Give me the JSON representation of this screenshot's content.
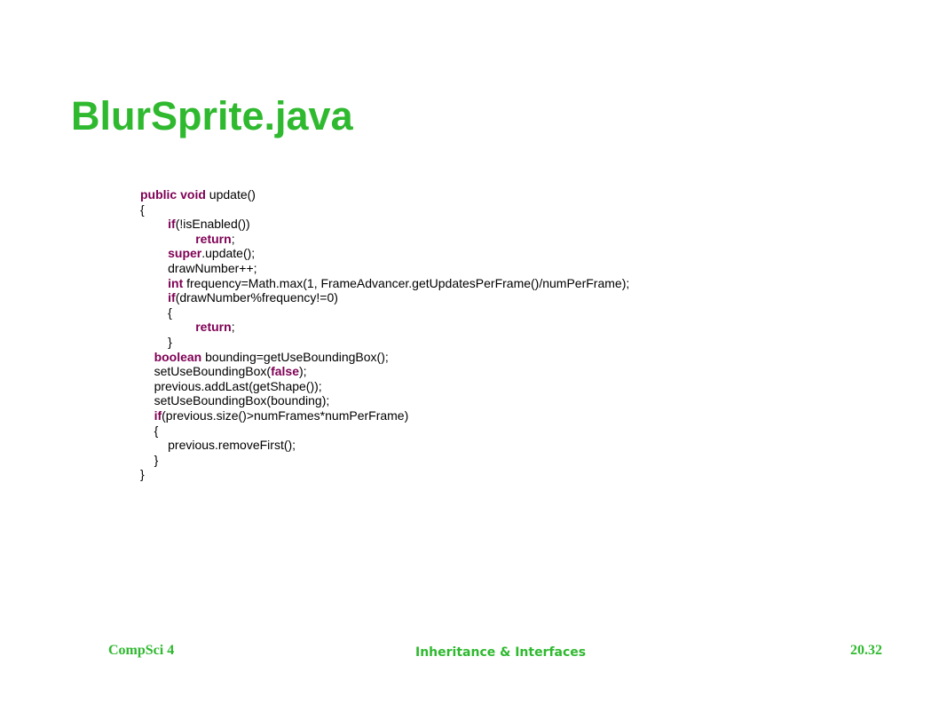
{
  "slide": {
    "title": "BlurSprite.java",
    "code_lines": [
      {
        "indent": "",
        "tokens": [
          {
            "t": "public",
            "kw": true
          },
          {
            "t": " "
          },
          {
            "t": "void",
            "kw": true
          },
          {
            "t": " update()"
          }
        ]
      },
      {
        "indent": "",
        "tokens": [
          {
            "t": "{"
          }
        ]
      },
      {
        "indent": "        ",
        "tokens": [
          {
            "t": "if",
            "kw": true
          },
          {
            "t": "(!isEnabled())"
          }
        ]
      },
      {
        "indent": "                ",
        "tokens": [
          {
            "t": "return",
            "kw": true
          },
          {
            "t": ";"
          }
        ]
      },
      {
        "indent": "        ",
        "tokens": [
          {
            "t": "super",
            "kw": true
          },
          {
            "t": ".update();"
          }
        ]
      },
      {
        "indent": "        ",
        "tokens": [
          {
            "t": "drawNumber++;"
          }
        ]
      },
      {
        "indent": "        ",
        "tokens": [
          {
            "t": "int",
            "kw": true
          },
          {
            "t": " frequency=Math.max(1, FrameAdvancer.getUpdatesPerFrame()/numPerFrame);"
          }
        ]
      },
      {
        "indent": "        ",
        "tokens": [
          {
            "t": "if",
            "kw": true
          },
          {
            "t": "(drawNumber%frequency!=0)"
          }
        ]
      },
      {
        "indent": "        ",
        "tokens": [
          {
            "t": "{"
          }
        ]
      },
      {
        "indent": "                ",
        "tokens": [
          {
            "t": "return",
            "kw": true
          },
          {
            "t": ";"
          }
        ]
      },
      {
        "indent": "        ",
        "tokens": [
          {
            "t": "}"
          }
        ]
      },
      {
        "indent": "    ",
        "tokens": [
          {
            "t": "boolean",
            "kw": true
          },
          {
            "t": " bounding=getUseBoundingBox();"
          }
        ]
      },
      {
        "indent": "    ",
        "tokens": [
          {
            "t": "setUseBoundingBox("
          },
          {
            "t": "false",
            "kw": true
          },
          {
            "t": ");"
          }
        ]
      },
      {
        "indent": "    ",
        "tokens": [
          {
            "t": "previous.addLast(getShape());"
          }
        ]
      },
      {
        "indent": "    ",
        "tokens": [
          {
            "t": "setUseBoundingBox(bounding);"
          }
        ]
      },
      {
        "indent": "    ",
        "tokens": [
          {
            "t": "if",
            "kw": true
          },
          {
            "t": "(previous.size()>numFrames*numPerFrame)"
          }
        ]
      },
      {
        "indent": "    ",
        "tokens": [
          {
            "t": "{"
          }
        ]
      },
      {
        "indent": "        ",
        "tokens": [
          {
            "t": "previous.removeFirst();"
          }
        ]
      },
      {
        "indent": "    ",
        "tokens": [
          {
            "t": "}"
          }
        ]
      },
      {
        "indent": "",
        "tokens": [
          {
            "t": "}"
          }
        ]
      }
    ]
  },
  "footer": {
    "left": "CompSci 4",
    "center": "Inheritance & Interfaces",
    "right": "20.32"
  },
  "colors": {
    "title": "#2fb92f",
    "keyword": "#7f0055",
    "text": "#000000"
  }
}
